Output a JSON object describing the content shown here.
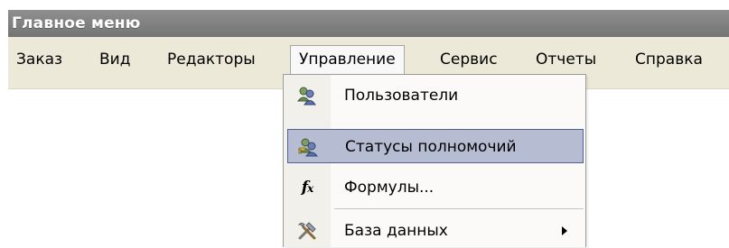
{
  "window": {
    "title": "Главное меню"
  },
  "menubar": {
    "items": [
      {
        "label": "Заказ"
      },
      {
        "label": "Вид"
      },
      {
        "label": "Редакторы"
      },
      {
        "label": "Управление",
        "open": true
      },
      {
        "label": "Сервис"
      },
      {
        "label": "Отчеты"
      },
      {
        "label": "Справка"
      }
    ]
  },
  "dropdown": {
    "items": [
      {
        "label": "Пользователи",
        "icon": "users-icon"
      },
      {
        "label": "Статусы полномочий",
        "icon": "permissions-icon",
        "highlighted": true
      },
      {
        "label": "Формулы...",
        "icon": "formula-icon"
      },
      {
        "label": "База данных",
        "icon": "tools-icon",
        "has_submenu": true
      }
    ]
  },
  "colors": {
    "titlebar": "#808080",
    "menubar": "#ece9d8",
    "highlight_fill": "#b6bdd2",
    "highlight_border": "#4f6096"
  }
}
